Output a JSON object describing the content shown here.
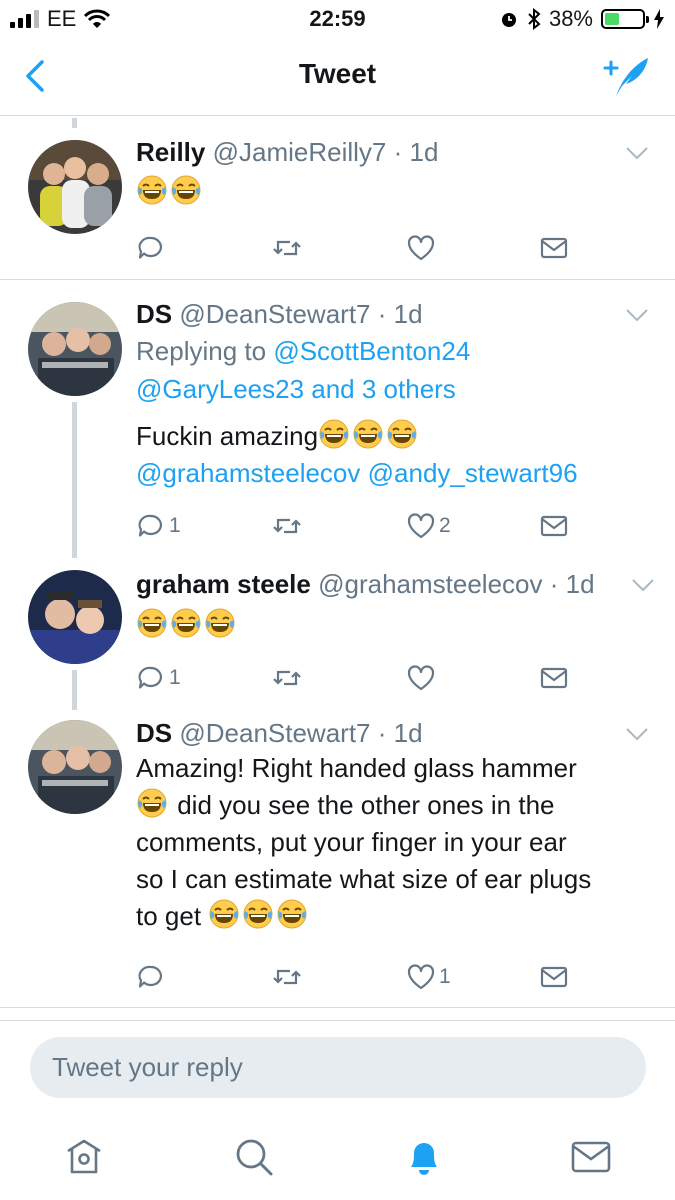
{
  "status_bar": {
    "carrier": "EE",
    "time": "22:59",
    "battery": "38%",
    "battery_level": 0.38
  },
  "nav": {
    "title": "Tweet"
  },
  "tweets": [
    {
      "name": "Reilly",
      "handle": "@JamieReilly7",
      "time": "1d",
      "text_emojis": 2,
      "replies": "",
      "likes": ""
    },
    {
      "name": "DS",
      "handle": "@DeanStewart7",
      "time": "1d",
      "replying_label": "Replying to",
      "replying_to_1": "@ScottBenton24",
      "replying_to_2": "@GaryLees23 and 3 others",
      "text": "Fuckin amazing",
      "mention_1": "@grahamsteelecov",
      "mention_2": "@andy_stewart96",
      "replies": "1",
      "likes": "2"
    },
    {
      "name": "graham steele",
      "handle": "@grahamsteelecov",
      "time": "1d",
      "replies": "1",
      "likes": ""
    },
    {
      "name": "DS",
      "handle": "@DeanStewart7",
      "time": "1d",
      "line1": "Amazing! Right handed glass hammer",
      "line2": " did you see the other ones in the",
      "line3": "comments, put your finger in your ear",
      "line4": "so I can estimate what size of ear plugs",
      "line5": "to get ",
      "replies": "",
      "likes": "1"
    }
  ],
  "reply_input": {
    "placeholder": "Tweet your reply"
  },
  "colors": {
    "accent": "#1da1f2",
    "secondary_text": "#657786",
    "divider": "#d8dde2",
    "battery": "#4cd964"
  }
}
